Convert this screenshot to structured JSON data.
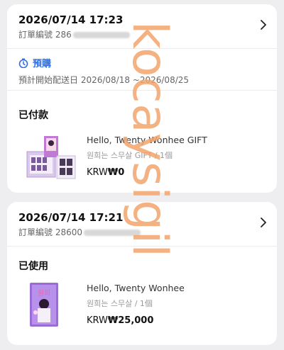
{
  "orders": [
    {
      "datetime": "2026/07/14 17:23",
      "order_no_label": "訂單編號",
      "order_no_visible": "286",
      "preorder_label": "預購",
      "preorder_dates": "預計開始配送日 2026/08/18 ~2026/08/25",
      "status": "已付款",
      "item_name": "Hello, Twenty Wonhee GIFT",
      "item_sub": "원희는 스무살 GIFT / 1個",
      "currency": "KRW",
      "price": "₩0"
    },
    {
      "datetime": "2026/07/14 17:21",
      "order_no_label": "訂單編號",
      "order_no_visible": "28600",
      "status": "已使用",
      "item_name": "Hello, Twenty Wonhee",
      "item_sub": "원희는 스무살 / 1個",
      "currency": "KRW",
      "price": "₩25,000"
    }
  ],
  "watermark": "kocaysigil",
  "colors": {
    "accent": "#2f6fe0",
    "watermark": "#f2a36b"
  },
  "icons": {
    "chevron": "chevron-right-icon",
    "clock": "clock-icon"
  }
}
